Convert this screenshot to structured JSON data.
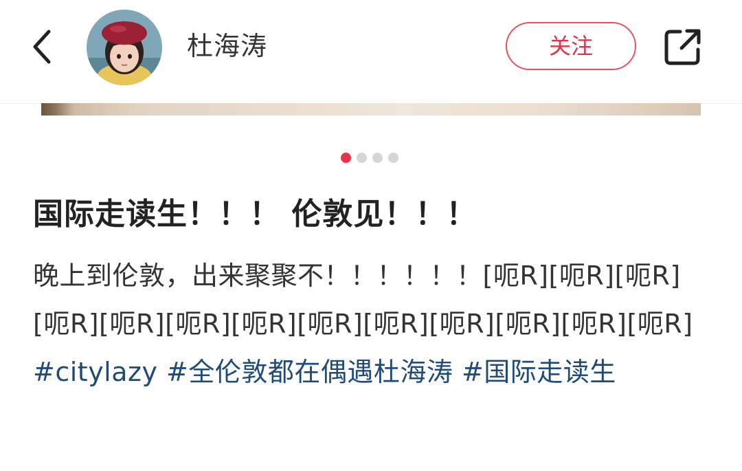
{
  "header": {
    "username": "杜海涛",
    "follow_label": "关注"
  },
  "carousel": {
    "total": 4,
    "active_index": 0
  },
  "post": {
    "title": "国际走读生！！！ 伦敦见！！！",
    "body_text": "晚上到伦敦，出来聚聚不！！！！！！[呃R][呃R][呃R][呃R][呃R][呃R][呃R][呃R][呃R][呃R][呃R][呃R][呃R] ",
    "hashtags": [
      "#citylazy ",
      "#全伦敦都在偶遇杜海涛 ",
      "#国际走读生"
    ]
  },
  "colors": {
    "accent": "#e0334a",
    "hashtag": "#1f4b79",
    "dot_active": "#e8344a",
    "dot_inactive": "#d6d6d6"
  },
  "icons": {
    "back": "chevron-left-icon",
    "share": "share-external-icon"
  }
}
